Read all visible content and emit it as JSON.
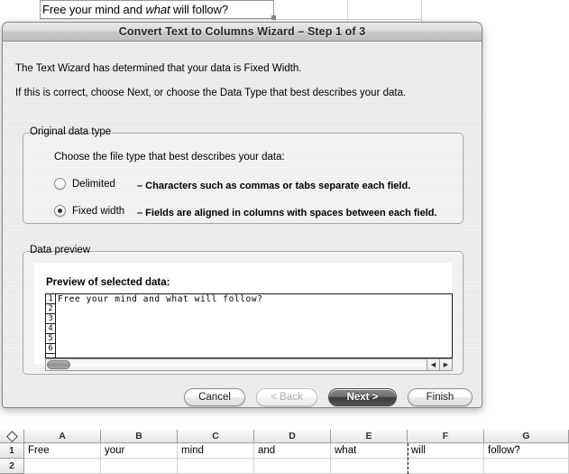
{
  "top_sheet": {
    "cell_text_prefix": "Free your mind and ",
    "cell_text_italic": "what",
    "cell_text_suffix": " will follow?"
  },
  "dialog": {
    "title": "Convert Text to Columns Wizard – Step 1 of 3",
    "paragraph1": "The Text Wizard has determined that your data is Fixed Width.",
    "paragraph2": "If this is correct, choose Next, or choose the Data Type that best describes your data.",
    "original_data_type": {
      "group_label": "Original data type",
      "prompt": "Choose the file type that best describes your data:",
      "options": [
        {
          "label": "Delimited",
          "description": "– Characters such as commas or tabs separate each field.",
          "selected": false
        },
        {
          "label": "Fixed width",
          "description": "– Fields are aligned in columns with spaces between each field.",
          "selected": true
        }
      ]
    },
    "data_preview": {
      "group_label": "Data preview",
      "panel_title": "Preview of selected data:",
      "row_numbers": [
        "1",
        "2",
        "3",
        "4",
        "5",
        "6"
      ],
      "lines": [
        "Free your mind and what will follow?",
        "",
        "",
        "",
        "",
        ""
      ],
      "scroll_left_arrow": "◀",
      "scroll_right_arrow": "▶"
    },
    "buttons": [
      {
        "label": "Cancel",
        "state": "normal"
      },
      {
        "label": "< Back",
        "state": "disabled"
      },
      {
        "label": "Next >",
        "state": "default"
      },
      {
        "label": "Finish",
        "state": "normal"
      }
    ]
  },
  "bottom_sheet": {
    "column_headers": [
      "A",
      "B",
      "C",
      "D",
      "E",
      "F",
      "G"
    ],
    "row_headers": [
      "1",
      "2"
    ],
    "rows": [
      [
        "Free",
        "your",
        "mind",
        "and",
        "what",
        "will",
        "follow?"
      ],
      [
        "",
        "",
        "",
        "",
        "",
        "",
        ""
      ]
    ],
    "corner_icon": "select-all-diamond-icon"
  },
  "colors": {
    "dialog_bg": "#ededed",
    "title_text": "#2a2a2a",
    "default_button_bg": "#3c3c3c",
    "grid_line": "#d0d0d0",
    "header_bg": "#e5e5e5"
  }
}
